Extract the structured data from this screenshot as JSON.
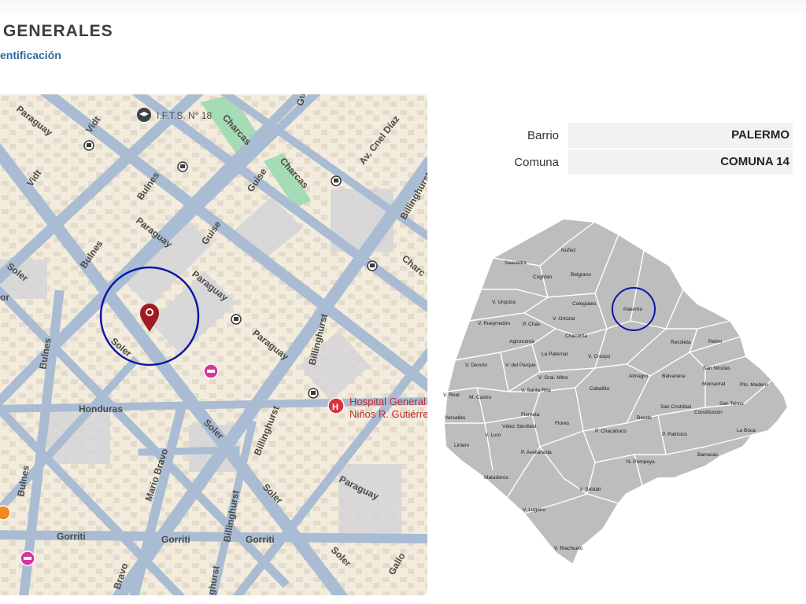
{
  "header": {
    "title": "GENERALES",
    "subtitle": "entificación"
  },
  "map": {
    "streets": {
      "paraguay_1": "Paraguay",
      "paraguay_2": "Paraguay",
      "paraguay_3": "Paraguay",
      "paraguay_4": "Paraguay",
      "paraguay_5": "Paraguay",
      "charcas_1": "Charcas",
      "charcas_2": "Charcas",
      "charcas_3": "Charc",
      "vidt_1": "Vidt",
      "vidt_2": "Vidt",
      "bulnes_1": "Bulnes",
      "bulnes_2": "Bulnes",
      "bulnes_3": "Bulnes",
      "bulnes_4": "Bulnes",
      "guise_1": "Guise",
      "guise_2": "Guise",
      "soler_1": "Soler",
      "soler_2": "Soler",
      "soler_3": "Soler",
      "soler_4": "Soler",
      "soler_5": "Soler",
      "av_coronel_diaz": "Av. Cnel Díaz",
      "billinghurst_1": "Billinghurst",
      "billinghurst_2": "Billinghurst",
      "billinghurst_3": "Billinghurst",
      "billinghurst_4": "Billinghurst",
      "billinghurst_5": "ghurst",
      "honduras": "Honduras",
      "mario_bravo": "Mario Bravo",
      "bravo": "Bravo",
      "gorriti_1": "Gorriti",
      "gorriti_2": "Gorriti",
      "gorriti_3": "Gorriti",
      "gallo": "Gallo",
      "gu_partial": "Gu",
      "or_partial": "or"
    },
    "poi_institute": "I.F.T.S. N° 18",
    "poi_hospital_line1": "Hospital General",
    "poi_hospital_line2": "Niños R. Gutiérre"
  },
  "info": {
    "barrio_label": "Barrio",
    "barrio_value": "PALERMO",
    "comuna_label": "Comuna",
    "comuna_value": "COMUNA 14"
  },
  "barrios": [
    {
      "name": "Núñez"
    },
    {
      "name": "Saavedra"
    },
    {
      "name": "Coghlan"
    },
    {
      "name": "Belgrano"
    },
    {
      "name": "V. Urquiza"
    },
    {
      "name": "Colegiales"
    },
    {
      "name": "Palermo"
    },
    {
      "name": "V. Pueyrredón"
    },
    {
      "name": "P. Chas"
    },
    {
      "name": "V. Ortúzar"
    },
    {
      "name": "Chacarita"
    },
    {
      "name": "Agronomía"
    },
    {
      "name": "Recoleta"
    },
    {
      "name": "Retiro"
    },
    {
      "name": "La Paternal"
    },
    {
      "name": "V. Crespo"
    },
    {
      "name": "V. Devoto"
    },
    {
      "name": "V. del Parque"
    },
    {
      "name": "San Nicolás"
    },
    {
      "name": "Almagro"
    },
    {
      "name": "Balvanera"
    },
    {
      "name": "V. Gral. Mitre"
    },
    {
      "name": "Monserrat"
    },
    {
      "name": "Pto. Madero"
    },
    {
      "name": "V. Real"
    },
    {
      "name": "M. Castro"
    },
    {
      "name": "V. Santa Rita"
    },
    {
      "name": "Caballito"
    },
    {
      "name": "San Cristóbal"
    },
    {
      "name": "San Telmo"
    },
    {
      "name": "Constitución"
    },
    {
      "name": "Versalles"
    },
    {
      "name": "Floresta"
    },
    {
      "name": "Boedo"
    },
    {
      "name": "Vélez Sársfield"
    },
    {
      "name": "Flores"
    },
    {
      "name": "P. Chacabuco"
    },
    {
      "name": "P. Patricios"
    },
    {
      "name": "La Boca"
    },
    {
      "name": "V. Luro"
    },
    {
      "name": "Liniers"
    },
    {
      "name": "Barracas"
    },
    {
      "name": "P. Avellaneda"
    },
    {
      "name": "N. Pompeya"
    },
    {
      "name": "Mataderos"
    },
    {
      "name": "V. Soldati"
    },
    {
      "name": "V. Lugano"
    },
    {
      "name": "V. Riachuelo"
    }
  ],
  "colors": {
    "accent_blue": "#0f15a8",
    "pin_red": "#a01a24",
    "hospital_red": "#d9343c",
    "subtitle_blue": "#2d6aa3",
    "street": "#a9bcd3",
    "block": "#f3ecdc",
    "building": "#d6d6d6",
    "park": "#a5dbb5",
    "comuna_fill": "#bdbdbd"
  }
}
